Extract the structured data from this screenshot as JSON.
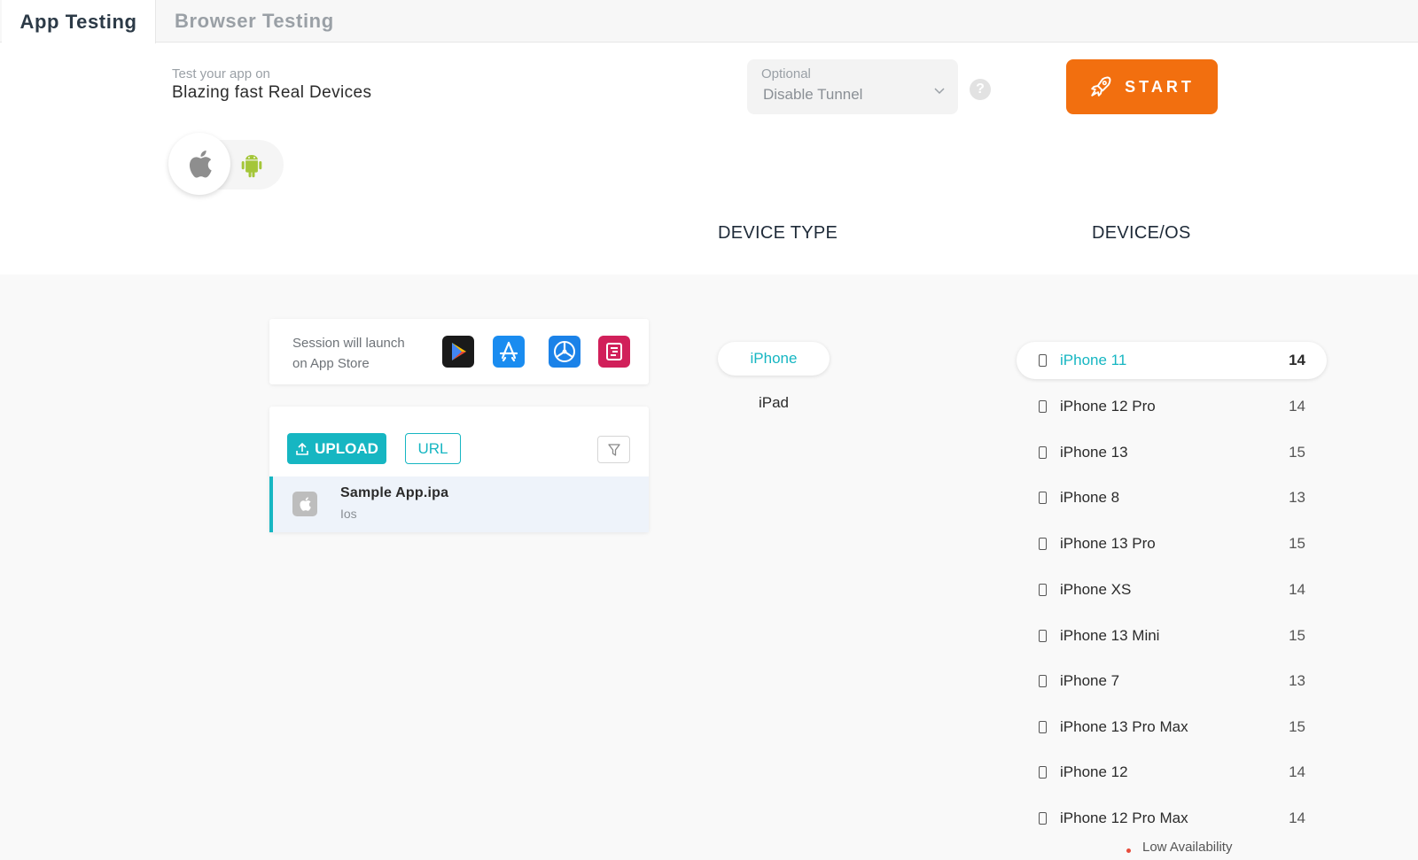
{
  "tabs": [
    {
      "label": "App Testing",
      "active": true
    },
    {
      "label": "Browser Testing",
      "active": false
    }
  ],
  "header": {
    "subtitle": "Test your app on",
    "headline": "Blazing fast Real Devices"
  },
  "tunnel": {
    "label": "Optional",
    "value": "Disable Tunnel"
  },
  "help_glyph": "?",
  "start_label": "START",
  "columns": {
    "device_type": "DEVICE TYPE",
    "device_os": "DEVICE/OS"
  },
  "session": {
    "line1": "Session will launch",
    "line2": "on App Store",
    "store_icons": [
      "google-play-icon",
      "app-store-icon",
      "test-flight-icon",
      "app-center-icon"
    ]
  },
  "upload": {
    "upload_label": "UPLOAD",
    "url_label": "URL"
  },
  "app": {
    "name": "Sample App.ipa",
    "platform": "Ios"
  },
  "device_types": [
    {
      "label": "iPhone",
      "selected": true
    },
    {
      "label": "iPad",
      "selected": false
    }
  ],
  "devices": [
    {
      "name": "iPhone 11",
      "os": "14",
      "selected": true
    },
    {
      "name": "iPhone 12 Pro",
      "os": "14"
    },
    {
      "name": "iPhone 13",
      "os": "15"
    },
    {
      "name": "iPhone 8",
      "os": "13"
    },
    {
      "name": "iPhone 13 Pro",
      "os": "15"
    },
    {
      "name": "iPhone XS",
      "os": "14"
    },
    {
      "name": "iPhone 13 Mini",
      "os": "15"
    },
    {
      "name": "iPhone 7",
      "os": "13"
    },
    {
      "name": "iPhone 13 Pro Max",
      "os": "15"
    },
    {
      "name": "iPhone 12",
      "os": "14"
    },
    {
      "name": "iPhone 12 Pro Max",
      "os": "14"
    }
  ],
  "low_availability": "Low Availability",
  "colors": {
    "accent": "#16b6c2",
    "start": "#f26f0f"
  }
}
